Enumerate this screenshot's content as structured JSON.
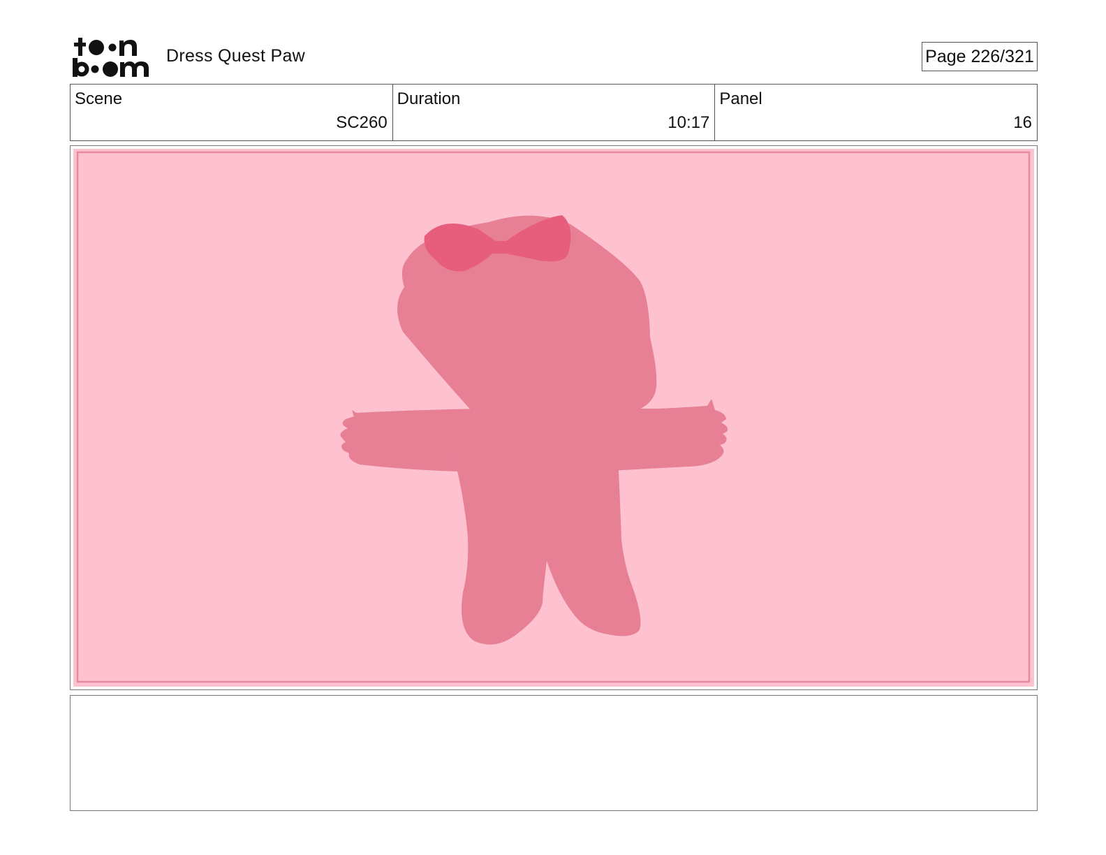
{
  "header": {
    "project_title": "Dress Quest Paw",
    "page_label": "Page 226/321"
  },
  "info": {
    "scene_label": "Scene",
    "scene_value": "SC260",
    "duration_label": "Duration",
    "duration_value": "10:17",
    "panel_label": "Panel",
    "panel_value": "16"
  },
  "panel": {
    "background_color": "#fdc1cf",
    "character_color": "#e77f95",
    "bow_color": "#e65e7c"
  },
  "notes": {
    "text": ""
  }
}
